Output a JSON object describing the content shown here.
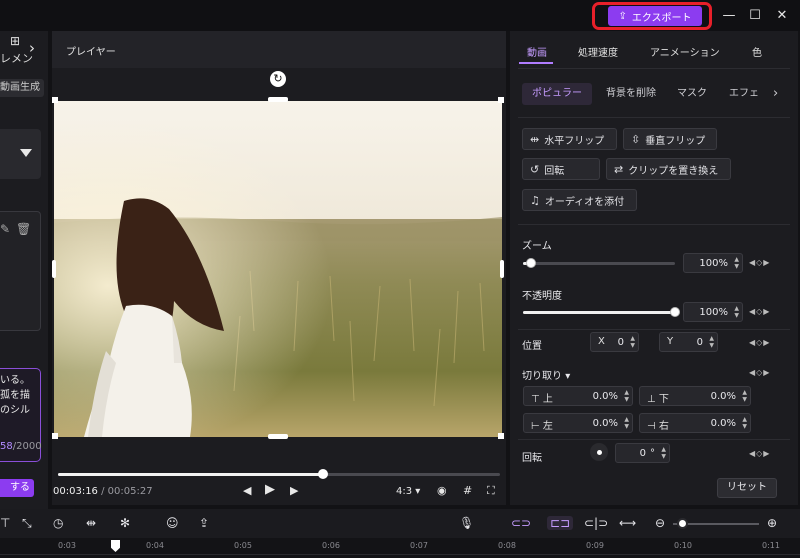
{
  "titlebar": {
    "export_label": "エクスポート",
    "minimize": "—",
    "maximize": "☐",
    "close": "✕"
  },
  "left_panel": {
    "tab_label": "レメン",
    "chip_label": "動画生成（",
    "prompt_lines": [
      "いる。",
      "孤を描",
      "のシル"
    ],
    "char_count": "58",
    "char_max": "/2000",
    "generate_label": "する"
  },
  "player": {
    "title": "プレイヤー",
    "current_time": "00:03:16",
    "separator": "/",
    "total_time": "00:05:27",
    "aspect_ratio": "4:3",
    "progress": 0.6
  },
  "properties": {
    "tabs": [
      "動画",
      "処理速度",
      "アニメーション",
      "色"
    ],
    "active_tab": "動画",
    "subtabs": [
      "ポピュラー",
      "背景を削除",
      "マスク",
      "エフェ"
    ],
    "actions": {
      "flip_h": "水平フリップ",
      "flip_v": "垂直フリップ",
      "rotate": "回転",
      "replace": "クリップを置き換え",
      "audio": "オーディオを添付"
    },
    "zoom": {
      "label": "ズーム",
      "value": "100%",
      "level": 0.05
    },
    "opacity": {
      "label": "不透明度",
      "value": "100%",
      "level": 1.0
    },
    "position": {
      "label": "位置",
      "x_label": "X",
      "x_value": "0",
      "y_label": "Y",
      "y_value": "0"
    },
    "crop": {
      "label": "切り取り",
      "top_label": "上",
      "top_value": "0.0%",
      "bottom_label": "下",
      "bottom_value": "0.0%",
      "left_label": "左",
      "left_value": "0.0%",
      "right_label": "右",
      "right_value": "0.0%"
    },
    "rotation": {
      "label": "回転",
      "value": "0",
      "unit": "°"
    },
    "reset_label": "リセット"
  },
  "timeline": {
    "ticks": [
      "0:03",
      "0:04",
      "0:05",
      "0:06",
      "0:07",
      "0:08",
      "0:09",
      "0:10",
      "0:11"
    ]
  },
  "colors": {
    "accent": "#8c3cf0",
    "accent_text": "#c59cff",
    "highlight": "#e8202a",
    "background": "#1c1c20"
  }
}
